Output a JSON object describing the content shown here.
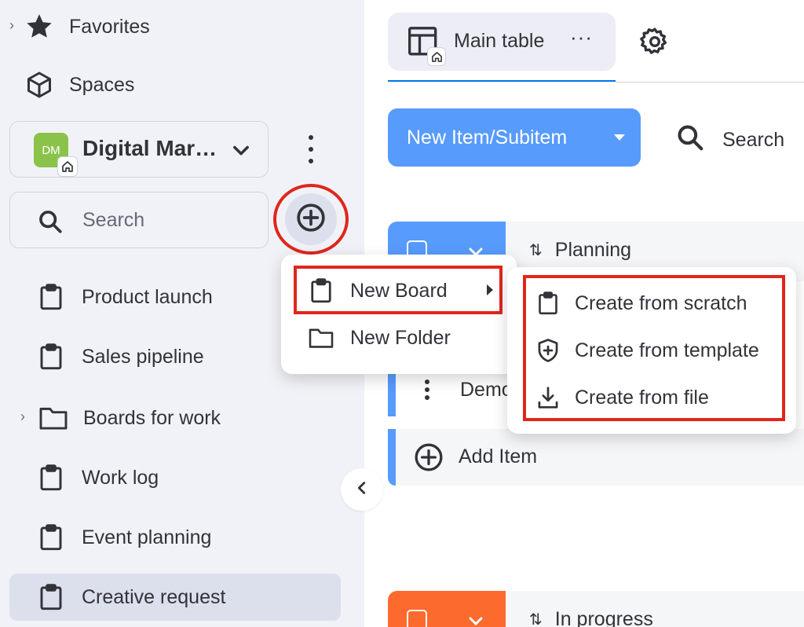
{
  "sidebar": {
    "favorites_label": "Favorites",
    "spaces_label": "Spaces",
    "workspace": {
      "initials": "DM",
      "name": "Digital Mar…",
      "color": "#8bc34a"
    },
    "search_placeholder": "Search",
    "items": [
      {
        "label": "Product launch",
        "icon": "board-icon"
      },
      {
        "label": "Sales pipeline",
        "icon": "board-icon"
      },
      {
        "label": "Boards for work",
        "icon": "folder-icon"
      },
      {
        "label": "Work log",
        "icon": "board-icon"
      },
      {
        "label": "Event planning",
        "icon": "board-icon"
      },
      {
        "label": "Creative request",
        "icon": "board-icon",
        "selected": true
      }
    ]
  },
  "add_menu": {
    "new_board": "New Board",
    "new_folder": "New Folder"
  },
  "board_submenu": {
    "scratch": "Create from scratch",
    "template": "Create from template",
    "file": "Create from file"
  },
  "main": {
    "view_tab_label": "Main table",
    "view_tab_more": "···",
    "new_item_label": "New Item/Subitem",
    "search_label": "Search",
    "groups": [
      {
        "name": "Planning",
        "color": "#579bfc"
      },
      {
        "name": "In progress",
        "color": "#fd6a2d"
      }
    ],
    "item_text": "Demo",
    "add_item_label": "Add Item"
  },
  "colors": {
    "accent": "#579bfc",
    "highlight": "#e0261b",
    "sidebar_bg": "#f1f2f7"
  }
}
